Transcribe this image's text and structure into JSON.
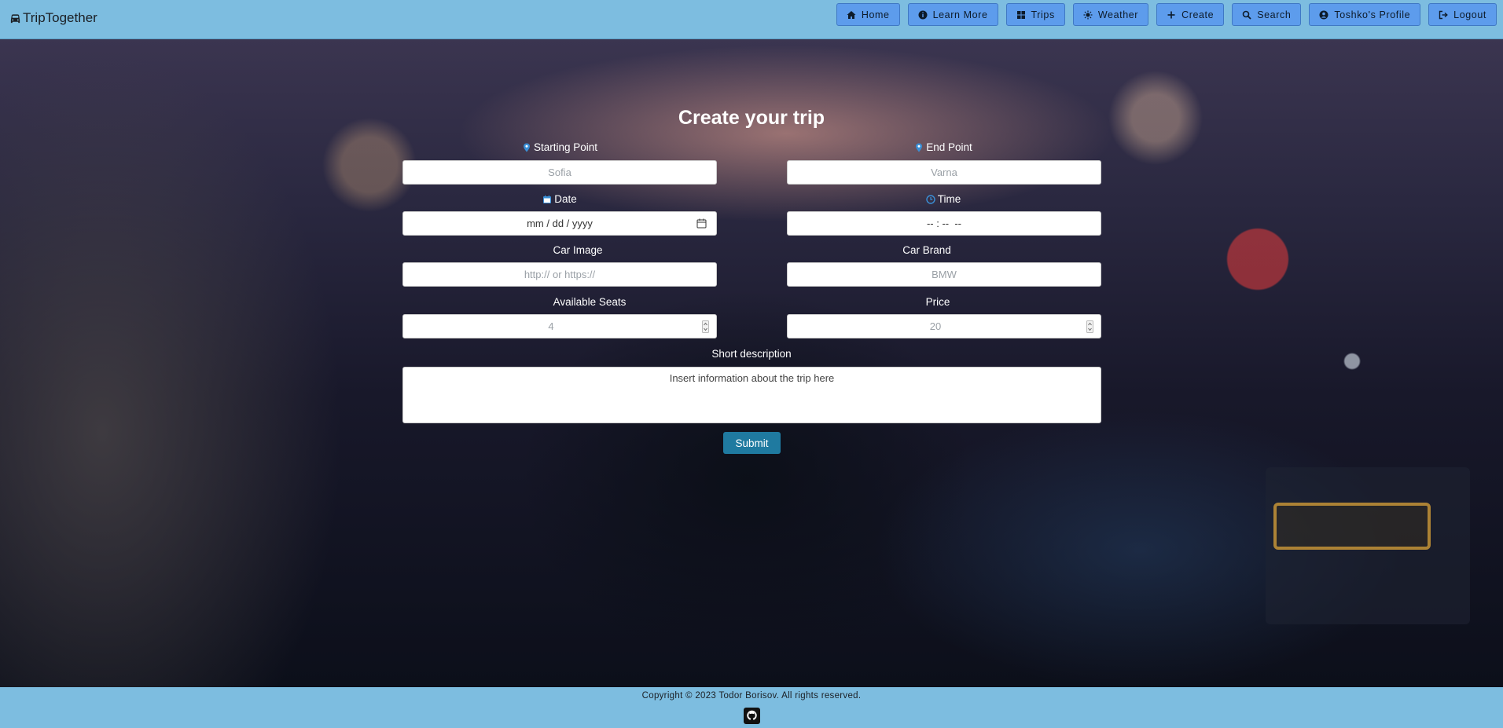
{
  "header": {
    "brand": "TripTogether",
    "nav": [
      {
        "label": "Home",
        "icon": "home-icon"
      },
      {
        "label": "Learn More",
        "icon": "info-icon"
      },
      {
        "label": "Trips",
        "icon": "grid-icon"
      },
      {
        "label": "Weather",
        "icon": "sun-icon"
      },
      {
        "label": "Create",
        "icon": "plus-icon"
      },
      {
        "label": "Search",
        "icon": "search-icon"
      },
      {
        "label": "Toshko's Profile",
        "icon": "user-circle-icon"
      },
      {
        "label": "Logout",
        "icon": "logout-icon"
      }
    ]
  },
  "form": {
    "title": "Create your trip",
    "start_label": "Starting Point",
    "start_placeholder": "Sofia",
    "end_label": "End Point",
    "end_placeholder": "Varna",
    "date_label": "Date",
    "date_placeholder": "mm / dd / yyyy",
    "time_label": "Time",
    "time_placeholder": "-- : --  --",
    "image_label": "Car Image",
    "image_placeholder": "http:// or https://",
    "brand_label": "Car Brand",
    "brand_placeholder": "BMW",
    "seats_label": "Available Seats",
    "seats_placeholder": "4",
    "price_label": "Price",
    "price_placeholder": "20",
    "description_label": "Short description",
    "description_placeholder": "Insert information about the trip here",
    "submit_label": "Submit"
  },
  "footer": {
    "copyright": "Copyright © 2023 Todor Borisov. All rights reserved."
  },
  "colors": {
    "bar": "#7dbde0",
    "nav_button": "#5d9cec",
    "submit": "#1f7aa0",
    "pin_icon": "#3a8fd6"
  }
}
